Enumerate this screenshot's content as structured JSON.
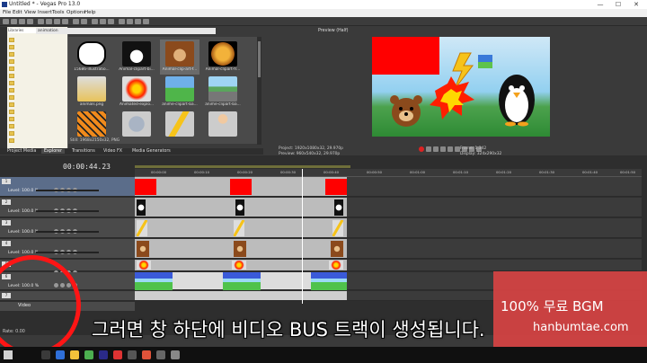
{
  "window": {
    "title": "Untitled * - Vegas Pro 13.0",
    "controls": [
      "—",
      "☐",
      "✕"
    ]
  },
  "menu": [
    "File",
    "Edit",
    "View",
    "Insert",
    "Tools",
    "Options",
    "Help"
  ],
  "explorer": {
    "path": "Libraries",
    "breadcrumb": "animation",
    "thumbnails": [
      {
        "caption": "15686-illustratio...",
        "icon": "speech-bubble-image"
      },
      {
        "caption": "Animal-clipart-bi...",
        "icon": "penguin-image"
      },
      {
        "caption": "Animal-clip-art-f...",
        "icon": "bear-image"
      },
      {
        "caption": "Animal-clipart-fr...",
        "icon": "lion-image"
      },
      {
        "caption": "animals.png",
        "icon": "giraffe-image"
      },
      {
        "caption": "Animated-explo...",
        "icon": "explosion-image"
      },
      {
        "caption": "anime-clipart-ba...",
        "icon": "landscape-image"
      },
      {
        "caption": "anime-clipart-ba...",
        "icon": "road-image"
      },
      {
        "caption": "",
        "icon": "tiger-image"
      },
      {
        "caption": "",
        "icon": "elephant-image"
      },
      {
        "caption": "",
        "icon": "lightning-image"
      },
      {
        "caption": "",
        "icon": "person-image"
      }
    ],
    "file_info": "Still: 1968x2150x32, PNG",
    "tabs": [
      "Project Media",
      "Explorer",
      "Transitions",
      "Video FX",
      "Media Generators"
    ],
    "active_tab": "Explorer"
  },
  "preview": {
    "mode_label": "Preview (Half)",
    "project_info": [
      "Project: 1920x1080x32, 29.970p",
      "Preview: 960x540x32, 29.970p"
    ],
    "frame_info": [
      "Frame: 1,342",
      "Display: 324x290x32"
    ]
  },
  "timeline": {
    "timecode": "00:00:44.23",
    "ruler_ticks": [
      "00:00:00",
      "00:00:10",
      "00:00:20",
      "00:00:30",
      "00:00:40",
      "00:00:50",
      "00:01:00",
      "00:01:10",
      "00:01:20",
      "00:01:30",
      "00:01:40",
      "00:01:50"
    ],
    "tracks": [
      {
        "num": "1",
        "level": "Level: 100.0 %"
      },
      {
        "num": "2",
        "level": "Level: 100.0 %"
      },
      {
        "num": "3",
        "level": "Level: 100.0 %"
      },
      {
        "num": "4",
        "level": "Level: 100.0 %"
      },
      {
        "num": "5",
        "level": ""
      },
      {
        "num": "6",
        "level": "Level: 100.0 %"
      },
      {
        "num": "7",
        "level": ""
      }
    ],
    "video_bus_label": "Video",
    "rate": "Rate: 0.00"
  },
  "overlay": {
    "subtitle": "그러면 창 하단에 비디오 BUS 트랙이 생성됩니다.",
    "watermark_line1": "100% 무료 BGM",
    "watermark_line2": "hanbumtae.com"
  },
  "colors": {
    "accent_red": "#ff0000",
    "circle": "#ff1515",
    "watermark_bg": "#e44444"
  }
}
